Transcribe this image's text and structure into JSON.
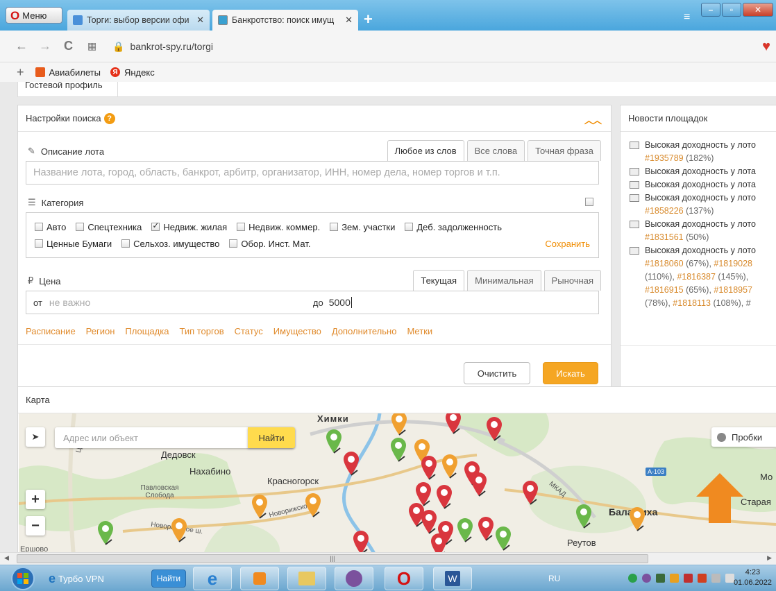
{
  "browser": {
    "menu_label": "Меню",
    "tabs": [
      {
        "title": "Торги: выбор версии офи",
        "active": false
      },
      {
        "title": "Банкротство: поиск имущ",
        "active": true
      }
    ],
    "url": "bankrot-spy.ru/torgi",
    "bookmarks": [
      "Авиабилеты",
      "Яндекс"
    ]
  },
  "page": {
    "guest_profile": "Гостевой профиль",
    "search": {
      "title": "Настройки поиска",
      "lot_description_label": "Описание лота",
      "match_modes": [
        "Любое из слов",
        "Все слова",
        "Точная фраза"
      ],
      "lot_placeholder": "Название лота, город, область, банкрот, арбитр, организатор, ИНН, номер дела, номер торгов и т.п.",
      "category_label": "Категория",
      "categories": [
        {
          "label": "Авто",
          "checked": false
        },
        {
          "label": "Спецтехника",
          "checked": false
        },
        {
          "label": "Недвиж. жилая",
          "checked": true
        },
        {
          "label": "Недвиж. коммер.",
          "checked": false
        },
        {
          "label": "Зем. участки",
          "checked": false
        },
        {
          "label": "Деб. задолженность",
          "checked": false
        },
        {
          "label": "Ценные Бумаги",
          "checked": false
        },
        {
          "label": "Сельхоз. имущество",
          "checked": false
        },
        {
          "label": "Обор. Инст. Мат.",
          "checked": false
        }
      ],
      "save_label": "Сохранить",
      "price_label": "Цена",
      "price_modes": [
        "Текущая",
        "Минимальная",
        "Рыночная"
      ],
      "from_label": "от",
      "from_placeholder": "не важно",
      "to_label": "до",
      "to_value": "5000",
      "filter_links": [
        "Расписание",
        "Регион",
        "Площадка",
        "Тип торгов",
        "Статус",
        "Имущество",
        "Дополнительно",
        "Метки"
      ],
      "clear_label": "Очистить",
      "find_label": "Искать"
    },
    "news": {
      "title": "Новости площадок",
      "items": [
        {
          "text": "Высокая доходность у лото"
        },
        {
          "text": "",
          "link": "#1935789",
          "pct": " (182%)"
        },
        {
          "text": "Высокая доходность у лота"
        },
        {
          "text": "Высокая доходность у лота"
        },
        {
          "text": "Высокая доходность у лото"
        },
        {
          "text": "",
          "link": "#1858226",
          "pct": " (137%)"
        },
        {
          "text": "Высокая доходность у лото"
        },
        {
          "text": "",
          "link": "#1831561",
          "pct": " (50%)"
        },
        {
          "text": "Высокая доходность у лото"
        },
        {
          "text": "",
          "link": "#1818060",
          "pct": " (67%), ",
          "link2": "#1819028"
        },
        {
          "text": "",
          "pct": "(110%), ",
          "link": "#1816387",
          "pct2": " (145%),"
        },
        {
          "text": "",
          "link": "#1816915",
          "pct": " (65%), ",
          "link2": "#1818957"
        },
        {
          "text": "",
          "pct": "(78%), ",
          "link": "#1818113",
          "pct2": " (108%), #"
        }
      ]
    },
    "map": {
      "title": "Карта",
      "search_placeholder": "Адрес или объект",
      "search_button": "Найти",
      "traffic_label": "Пробки",
      "road_badge": "А-103",
      "places": [
        "Химки",
        "Дедовск",
        "Нахабино",
        "Красногорск",
        "Павловская Слобода",
        "Балашиха",
        "Реутов",
        "Старая",
        "Ершово",
        "МКАД",
        "ЦКАД",
        "Новорижское ш.",
        "Новорижско",
        "Мо"
      ]
    }
  },
  "taskbar": {
    "vpn_label": "Турбо VPN",
    "vpn_button": "Найти",
    "lang": "RU",
    "time": "4:23",
    "date": "01.06.2022"
  },
  "colors": {
    "accent": "#f5a623",
    "link": "#e08a2b",
    "pin_red": "#d9363e",
    "pin_green": "#6ab84a",
    "pin_orange": "#f0a030"
  }
}
